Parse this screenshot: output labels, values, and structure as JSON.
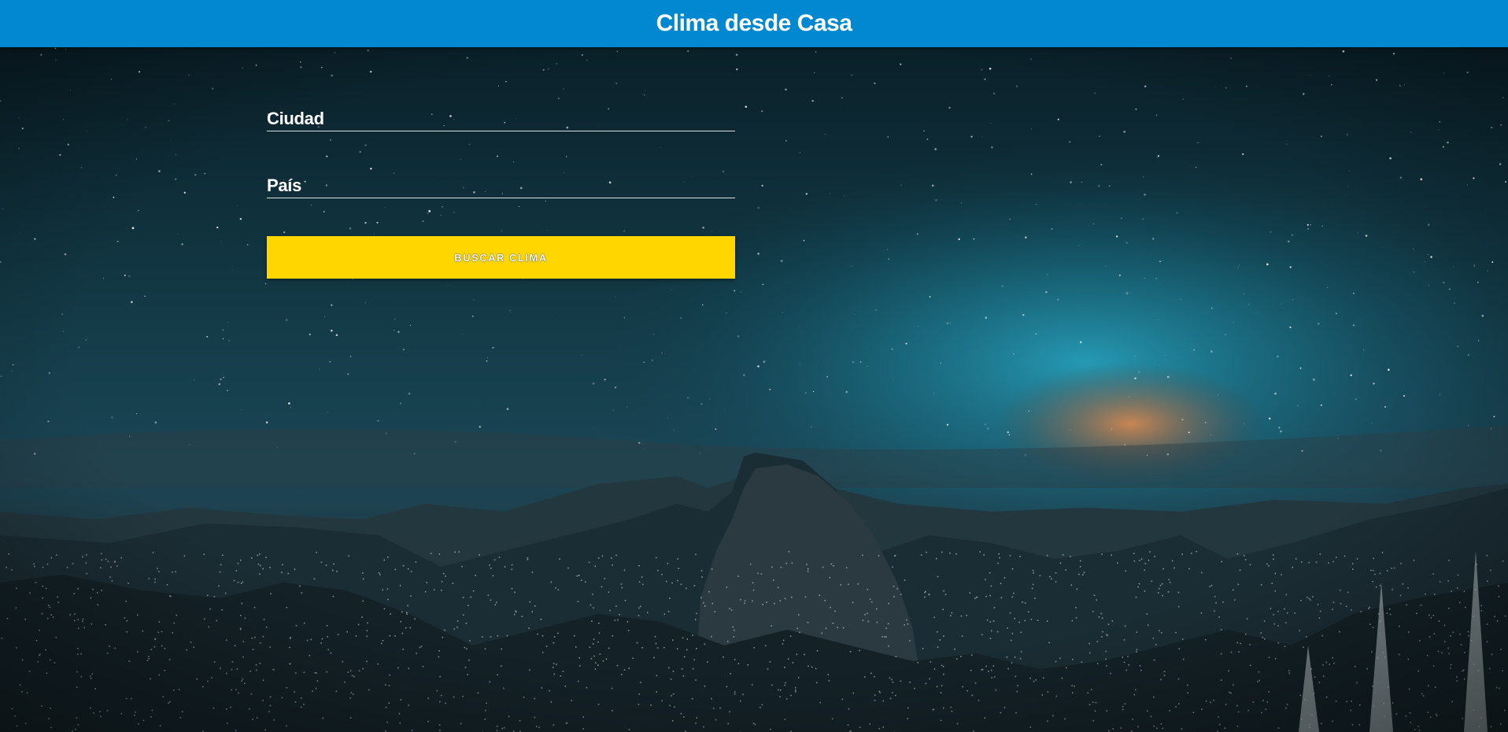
{
  "header": {
    "title": "Clima desde Casa"
  },
  "form": {
    "city_label": "Ciudad",
    "country_label": "País",
    "city_value": "",
    "country_value": "",
    "submit_label": "Buscar Clima"
  },
  "colors": {
    "header_bg": "#0288d1",
    "button_bg": "#ffd600",
    "sky_dark": "#0d2630",
    "sky_glow": "#1aa3c4"
  }
}
